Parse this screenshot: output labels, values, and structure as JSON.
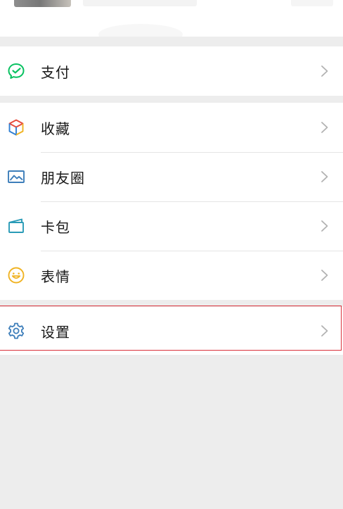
{
  "colors": {
    "background": "#ededed",
    "row_background": "#ffffff",
    "label_text": "#191919",
    "chevron": "#b2b2b2",
    "highlight_border": "#d9303a",
    "pay_icon": "#07c160",
    "moments_icon": "#3d7eba",
    "cards_icon": "#2a9bb7",
    "stickers_icon": "#f0b323",
    "settings_icon": "#3d7eba"
  },
  "menu": {
    "pay": {
      "label": "支付",
      "icon": "wechat-pay-icon"
    },
    "favorites": {
      "label": "收藏",
      "icon": "cube-icon"
    },
    "moments": {
      "label": "朋友圈",
      "icon": "picture-icon"
    },
    "cards": {
      "label": "卡包",
      "icon": "card-holder-icon"
    },
    "stickers": {
      "label": "表情",
      "icon": "smiley-icon"
    },
    "settings": {
      "label": "设置",
      "icon": "gear-icon"
    }
  }
}
